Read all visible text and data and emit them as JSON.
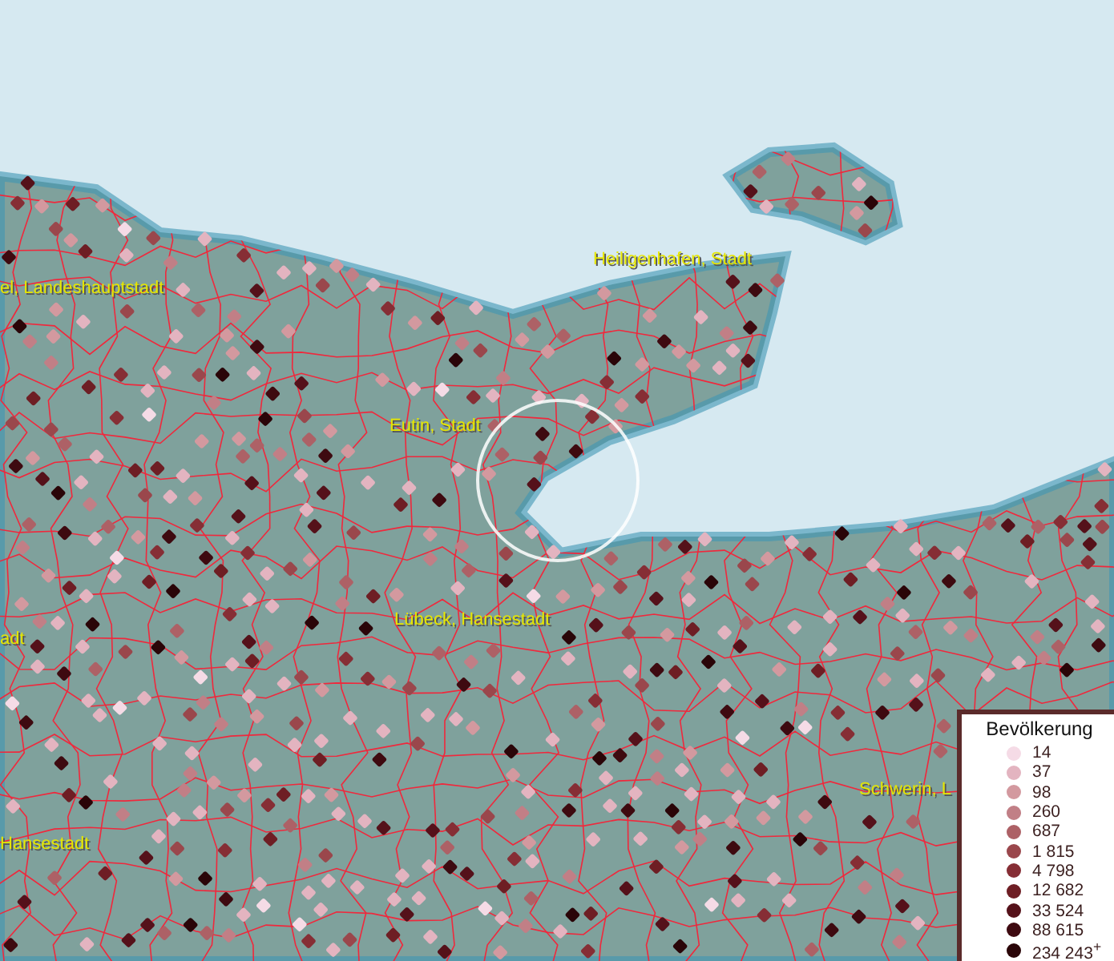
{
  "map": {
    "place_labels": [
      {
        "text": "el, Landeshauptstadt"
      },
      {
        "text": "Heiligenhafen, Stadt"
      },
      {
        "text": "Eutin, Stadt"
      },
      {
        "text": "Lübeck, Hansestadt"
      },
      {
        "text": "adt"
      },
      {
        "text": "Hansestadt"
      },
      {
        "text": "Schwerin, L"
      }
    ]
  },
  "legend": {
    "title": "Bevölkerung",
    "items": [
      {
        "label": "14",
        "color": "#f5dbe6"
      },
      {
        "label": "37",
        "color": "#e3b4c0"
      },
      {
        "label": "98",
        "color": "#d3999f"
      },
      {
        "label": "260",
        "color": "#c17f86"
      },
      {
        "label": "687",
        "color": "#ad6166"
      },
      {
        "label": "1 815",
        "color": "#9a474c"
      },
      {
        "label": "4 798",
        "color": "#862e35"
      },
      {
        "label": "12 682",
        "color": "#6e1e24"
      },
      {
        "label": "33 524",
        "color": "#55111a"
      },
      {
        "label": "88 615",
        "color": "#3e0a10"
      },
      {
        "label": "234 243$^{+}$",
        "color": "#2a0508"
      }
    ]
  }
}
